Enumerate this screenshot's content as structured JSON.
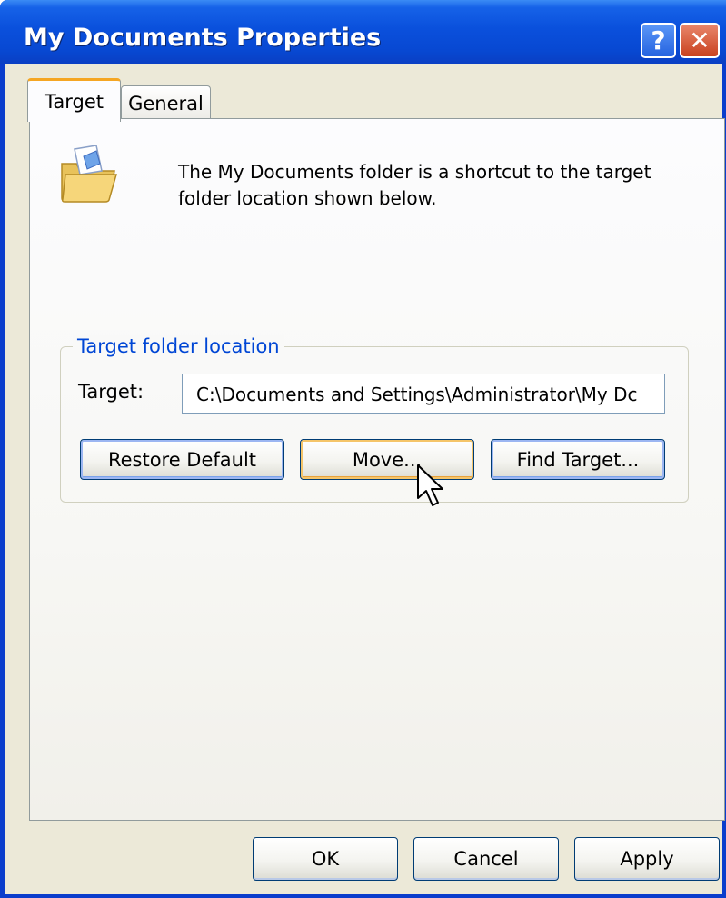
{
  "window": {
    "title": "My Documents Properties"
  },
  "titlebar": {
    "help_label": "?",
    "close_label": "✕"
  },
  "tabs": [
    {
      "label": "Target",
      "selected": true
    },
    {
      "label": "General",
      "selected": false
    }
  ],
  "description": "The My Documents folder is a shortcut to the target folder location shown below.",
  "group": {
    "legend": "Target folder location",
    "target_label": "Target:",
    "target_value": "C:\\Documents and Settings\\Administrator\\My Dc"
  },
  "buttons": {
    "restore_default": "Restore Default",
    "move": "Move...",
    "find_target": "Find Target...",
    "ok": "OK",
    "cancel": "Cancel",
    "apply": "Apply"
  },
  "icons": {
    "folder": "my-documents-folder-icon",
    "cursor": "mouse-pointer-icon"
  },
  "colors": {
    "titlebar": "#0a50dc",
    "legend_text": "#0046d5",
    "selected_tab_accent": "#f5a623"
  }
}
